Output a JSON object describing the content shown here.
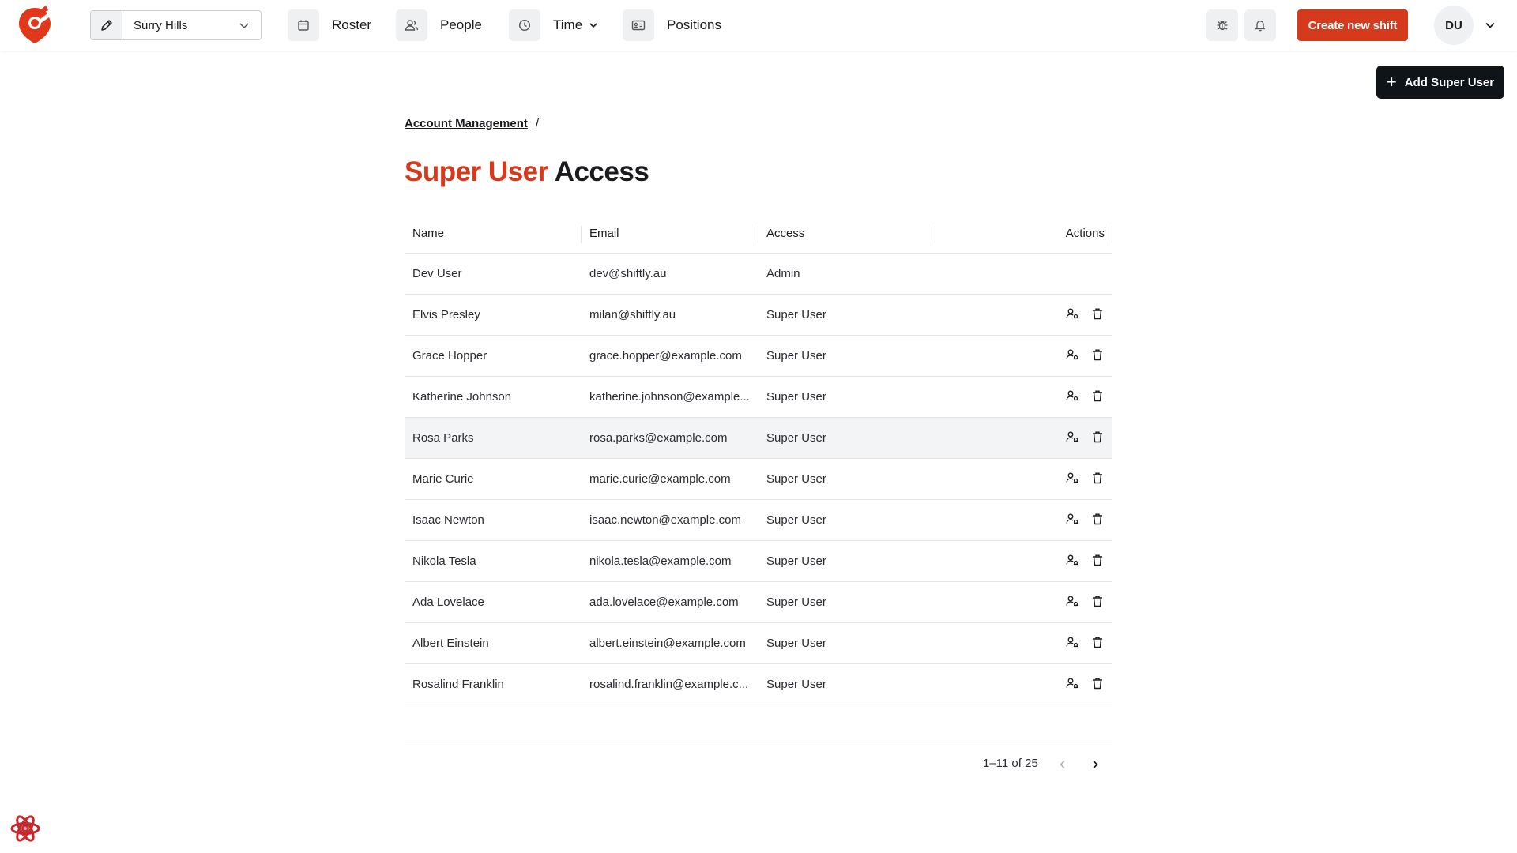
{
  "header": {
    "venue": "Surry Hills",
    "nav": {
      "roster": "Roster",
      "people": "People",
      "time": "Time",
      "positions": "Positions"
    },
    "create_button": "Create new shift",
    "avatar_initials": "DU"
  },
  "add_button": "Add Super User",
  "breadcrumb": {
    "item": "Account Management",
    "separator": "/"
  },
  "title": {
    "accent": "Super User",
    "rest": "Access"
  },
  "table": {
    "columns": {
      "name": "Name",
      "email": "Email",
      "access": "Access",
      "actions": "Actions"
    },
    "rows": [
      {
        "name": "Dev User",
        "email": "dev@shiftly.au",
        "access": "Admin",
        "has_actions": false
      },
      {
        "name": "Elvis Presley",
        "email": "milan@shiftly.au",
        "access": "Super User",
        "has_actions": true
      },
      {
        "name": "Grace Hopper",
        "email": "grace.hopper@example.com",
        "access": "Super User",
        "has_actions": true
      },
      {
        "name": "Katherine Johnson",
        "email": "katherine.johnson@example...",
        "access": "Super User",
        "has_actions": true
      },
      {
        "name": "Rosa Parks",
        "email": "rosa.parks@example.com",
        "access": "Super User",
        "has_actions": true,
        "highlighted": true
      },
      {
        "name": "Marie Curie",
        "email": "marie.curie@example.com",
        "access": "Super User",
        "has_actions": true
      },
      {
        "name": "Isaac Newton",
        "email": "isaac.newton@example.com",
        "access": "Super User",
        "has_actions": true
      },
      {
        "name": "Nikola Tesla",
        "email": "nikola.tesla@example.com",
        "access": "Super User",
        "has_actions": true
      },
      {
        "name": "Ada Lovelace",
        "email": "ada.lovelace@example.com",
        "access": "Super User",
        "has_actions": true
      },
      {
        "name": "Albert Einstein",
        "email": "albert.einstein@example.com",
        "access": "Super User",
        "has_actions": true
      },
      {
        "name": "Rosalind Franklin",
        "email": "rosalind.franklin@example.c...",
        "access": "Super User",
        "has_actions": true
      }
    ]
  },
  "pagination": {
    "text": "1–11 of 25"
  },
  "colors": {
    "accent": "#d63a1c",
    "dark_button": "#0f1419",
    "highlight_row": "#f3f4f6"
  }
}
